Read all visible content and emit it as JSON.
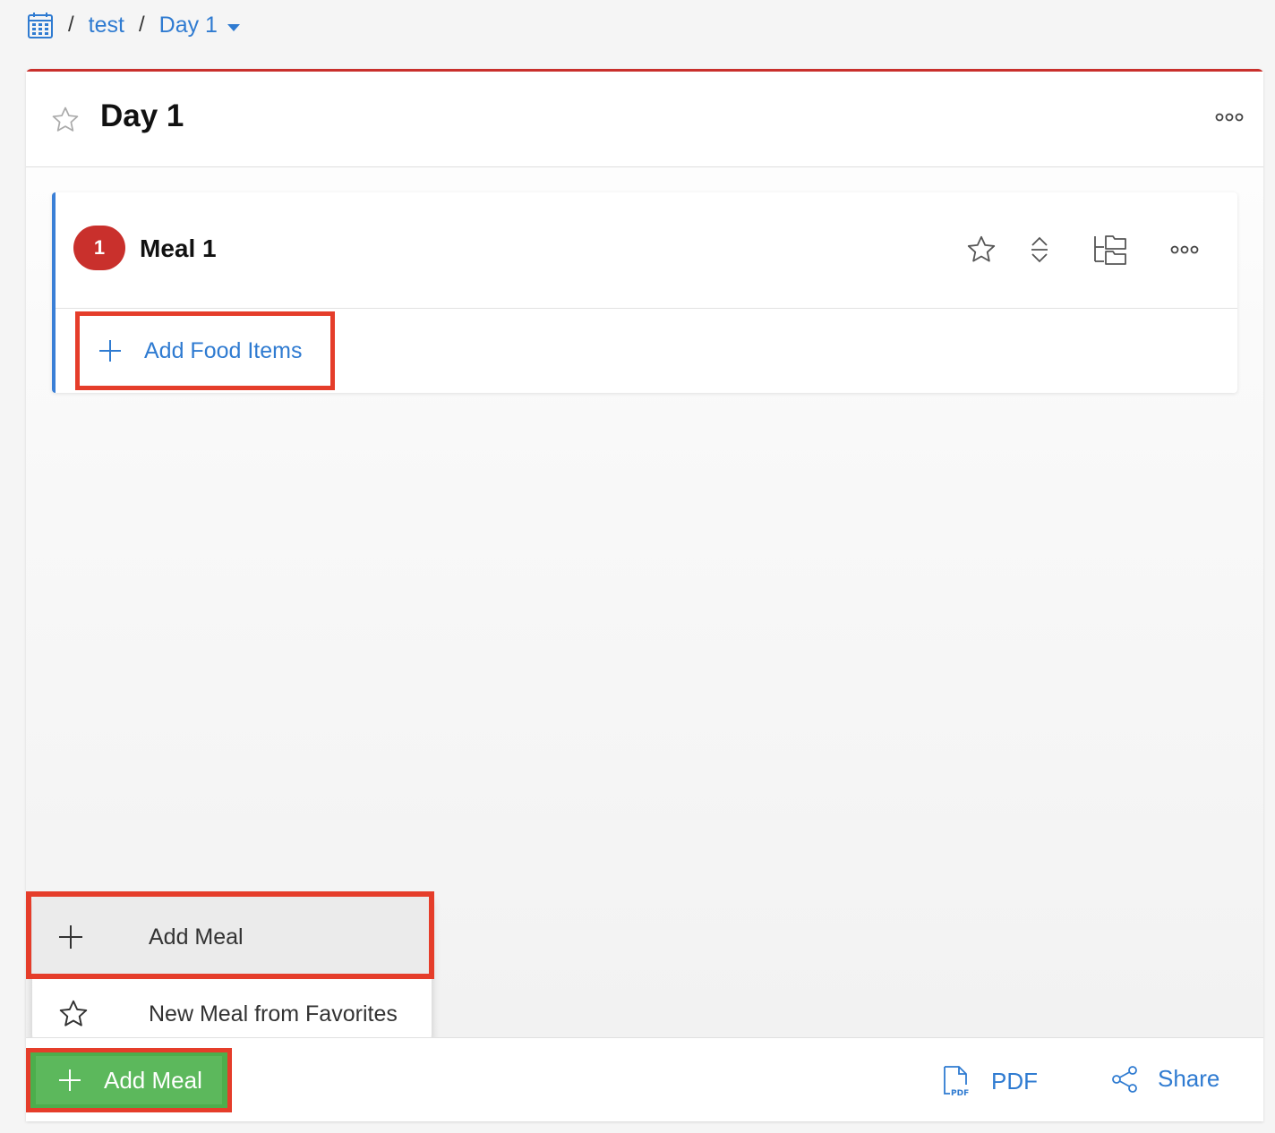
{
  "breadcrumb": {
    "icon": "calendar-icon",
    "sep1": "/",
    "project": "test",
    "sep2": "/",
    "current": "Day 1"
  },
  "day": {
    "title": "Day 1"
  },
  "meal": {
    "number": "1",
    "title": "Meal 1",
    "add_food_label": "Add Food Items"
  },
  "menu": {
    "add_meal": "Add Meal",
    "from_favorites": "New Meal from Favorites"
  },
  "footer": {
    "add_meal": "Add Meal",
    "pdf": "PDF",
    "share": "Share"
  },
  "colors": {
    "accent_blue": "#2f7bd1",
    "header_red": "#c9302c",
    "button_green": "#5cb85c",
    "highlight_red": "#e53d2a"
  }
}
